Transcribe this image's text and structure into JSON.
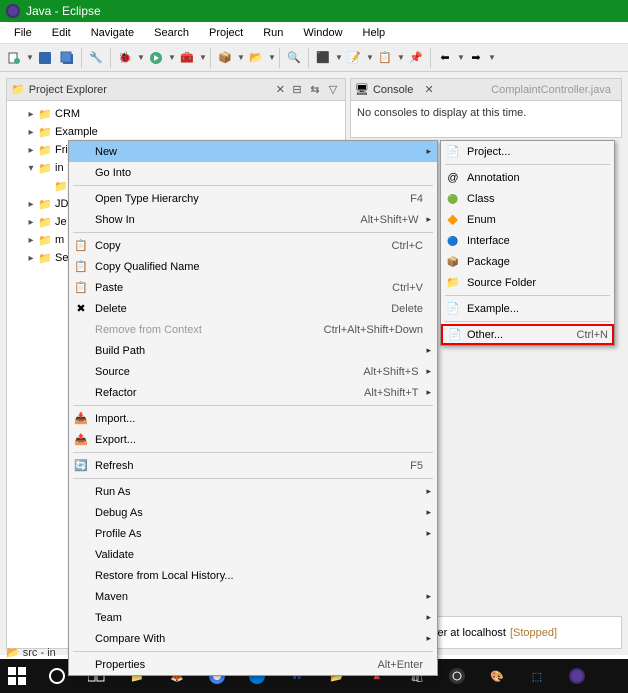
{
  "titlebar": {
    "title": "Java - Eclipse"
  },
  "menubar": [
    "File",
    "Edit",
    "Navigate",
    "Search",
    "Project",
    "Run",
    "Window",
    "Help"
  ],
  "explorer": {
    "title": "Project Explorer",
    "items": [
      {
        "name": "CRM",
        "depth": 1,
        "twist": "▸"
      },
      {
        "name": "Example",
        "depth": 1,
        "twist": "▸"
      },
      {
        "name": "FriendCircle",
        "depth": 1,
        "twist": "▸"
      },
      {
        "name": "in",
        "depth": 1,
        "twist": "▾"
      },
      {
        "name": "",
        "depth": 2,
        "twist": ""
      },
      {
        "name": "JD",
        "depth": 1,
        "twist": "▸"
      },
      {
        "name": "Je",
        "depth": 1,
        "twist": "▸"
      },
      {
        "name": "m",
        "depth": 1,
        "twist": "▸"
      },
      {
        "name": "Se",
        "depth": 1,
        "twist": "▸"
      }
    ]
  },
  "console": {
    "tab": "Console",
    "inactive_tab": "ComplaintController.java",
    "message": "No consoles to display at this time."
  },
  "server": {
    "label": "cat v7.0 Server at localhost",
    "status": "[Stopped]"
  },
  "status": "src - in",
  "context_menu": {
    "items": [
      {
        "icon": "",
        "label": "New",
        "shortcut": "",
        "arrow": "▸",
        "hover": true
      },
      {
        "icon": "",
        "label": "Go Into",
        "shortcut": "",
        "arrow": ""
      },
      {
        "sep": true
      },
      {
        "icon": "",
        "label": "Open Type Hierarchy",
        "shortcut": "F4",
        "arrow": ""
      },
      {
        "icon": "",
        "label": "Show In",
        "shortcut": "Alt+Shift+W",
        "arrow": "▸"
      },
      {
        "sep": true
      },
      {
        "icon": "📋",
        "label": "Copy",
        "shortcut": "Ctrl+C",
        "arrow": ""
      },
      {
        "icon": "📋",
        "label": "Copy Qualified Name",
        "shortcut": "",
        "arrow": ""
      },
      {
        "icon": "📋",
        "label": "Paste",
        "shortcut": "Ctrl+V",
        "arrow": ""
      },
      {
        "icon": "✖",
        "label": "Delete",
        "shortcut": "Delete",
        "arrow": ""
      },
      {
        "icon": "",
        "label": "Remove from Context",
        "shortcut": "Ctrl+Alt+Shift+Down",
        "arrow": "",
        "disabled": true
      },
      {
        "icon": "",
        "label": "Build Path",
        "shortcut": "",
        "arrow": "▸"
      },
      {
        "icon": "",
        "label": "Source",
        "shortcut": "Alt+Shift+S",
        "arrow": "▸"
      },
      {
        "icon": "",
        "label": "Refactor",
        "shortcut": "Alt+Shift+T",
        "arrow": "▸"
      },
      {
        "sep": true
      },
      {
        "icon": "📥",
        "label": "Import...",
        "shortcut": "",
        "arrow": ""
      },
      {
        "icon": "📤",
        "label": "Export...",
        "shortcut": "",
        "arrow": ""
      },
      {
        "sep": true
      },
      {
        "icon": "🔄",
        "label": "Refresh",
        "shortcut": "F5",
        "arrow": ""
      },
      {
        "sep": true
      },
      {
        "icon": "",
        "label": "Run As",
        "shortcut": "",
        "arrow": "▸"
      },
      {
        "icon": "",
        "label": "Debug As",
        "shortcut": "",
        "arrow": "▸"
      },
      {
        "icon": "",
        "label": "Profile As",
        "shortcut": "",
        "arrow": "▸"
      },
      {
        "icon": "",
        "label": "Validate",
        "shortcut": "",
        "arrow": ""
      },
      {
        "icon": "",
        "label": "Restore from Local History...",
        "shortcut": "",
        "arrow": ""
      },
      {
        "icon": "",
        "label": "Maven",
        "shortcut": "",
        "arrow": "▸"
      },
      {
        "icon": "",
        "label": "Team",
        "shortcut": "",
        "arrow": "▸"
      },
      {
        "icon": "",
        "label": "Compare With",
        "shortcut": "",
        "arrow": "▸"
      },
      {
        "sep": true
      },
      {
        "icon": "",
        "label": "Properties",
        "shortcut": "Alt+Enter",
        "arrow": ""
      }
    ]
  },
  "submenu": {
    "items": [
      {
        "icon": "file-ic",
        "label": "Project...",
        "shortcut": ""
      },
      {
        "sep": true
      },
      {
        "icon": "",
        "label": "Annotation",
        "shortcut": "",
        "glyph": "@"
      },
      {
        "icon": "class-ic",
        "label": "Class",
        "shortcut": ""
      },
      {
        "icon": "enum-ic",
        "label": "Enum",
        "shortcut": ""
      },
      {
        "icon": "iface-ic",
        "label": "Interface",
        "shortcut": ""
      },
      {
        "icon": "pkg-ic",
        "label": "Package",
        "shortcut": ""
      },
      {
        "icon": "folder-ic",
        "label": "Source Folder",
        "shortcut": ""
      },
      {
        "sep": true
      },
      {
        "icon": "file-ic",
        "label": "Example...",
        "shortcut": ""
      },
      {
        "sep": true
      },
      {
        "icon": "file-ic",
        "label": "Other...",
        "shortcut": "Ctrl+N",
        "highlight": true
      }
    ]
  }
}
